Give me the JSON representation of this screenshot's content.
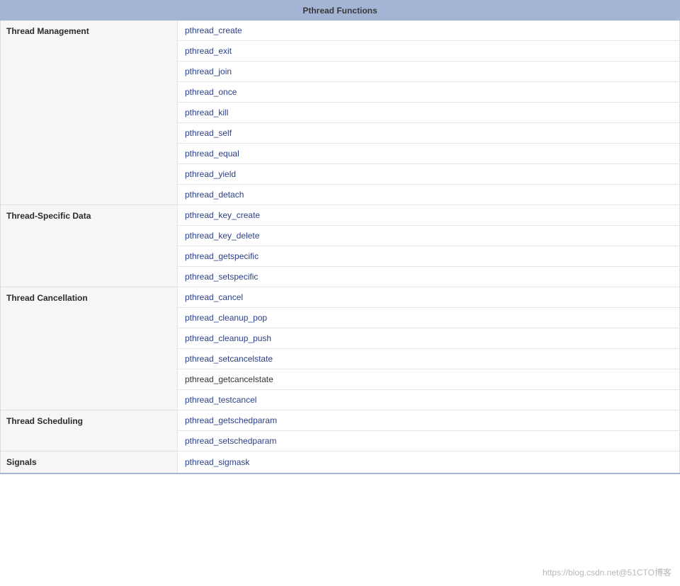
{
  "title": "Pthread Functions",
  "watermark": "https://blog.csdn.net@51CTO博客",
  "groups": [
    {
      "category": "Thread Management",
      "functions": [
        {
          "name": "pthread_create",
          "link": true
        },
        {
          "name": "pthread_exit",
          "link": true
        },
        {
          "name": "pthread_join",
          "link": true
        },
        {
          "name": "pthread_once",
          "link": true
        },
        {
          "name": "pthread_kill",
          "link": true
        },
        {
          "name": "pthread_self",
          "link": true
        },
        {
          "name": "pthread_equal",
          "link": true
        },
        {
          "name": "pthread_yield",
          "link": true
        },
        {
          "name": "pthread_detach",
          "link": true
        }
      ]
    },
    {
      "category": "Thread-Specific Data",
      "functions": [
        {
          "name": "pthread_key_create",
          "link": true
        },
        {
          "name": "pthread_key_delete",
          "link": true
        },
        {
          "name": "pthread_getspecific",
          "link": true
        },
        {
          "name": "pthread_setspecific",
          "link": true
        }
      ]
    },
    {
      "category": "Thread Cancellation",
      "functions": [
        {
          "name": "pthread_cancel",
          "link": true
        },
        {
          "name": "pthread_cleanup_pop",
          "link": true
        },
        {
          "name": "pthread_cleanup_push",
          "link": true
        },
        {
          "name": "pthread_setcancelstate",
          "link": true
        },
        {
          "name": "pthread_getcancelstate",
          "link": false
        },
        {
          "name": "pthread_testcancel",
          "link": true
        }
      ]
    },
    {
      "category": "Thread Scheduling",
      "functions": [
        {
          "name": "pthread_getschedparam",
          "link": true
        },
        {
          "name": "pthread_setschedparam",
          "link": true
        }
      ]
    },
    {
      "category": "Signals",
      "functions": [
        {
          "name": "pthread_sigmask",
          "link": true
        }
      ]
    }
  ]
}
